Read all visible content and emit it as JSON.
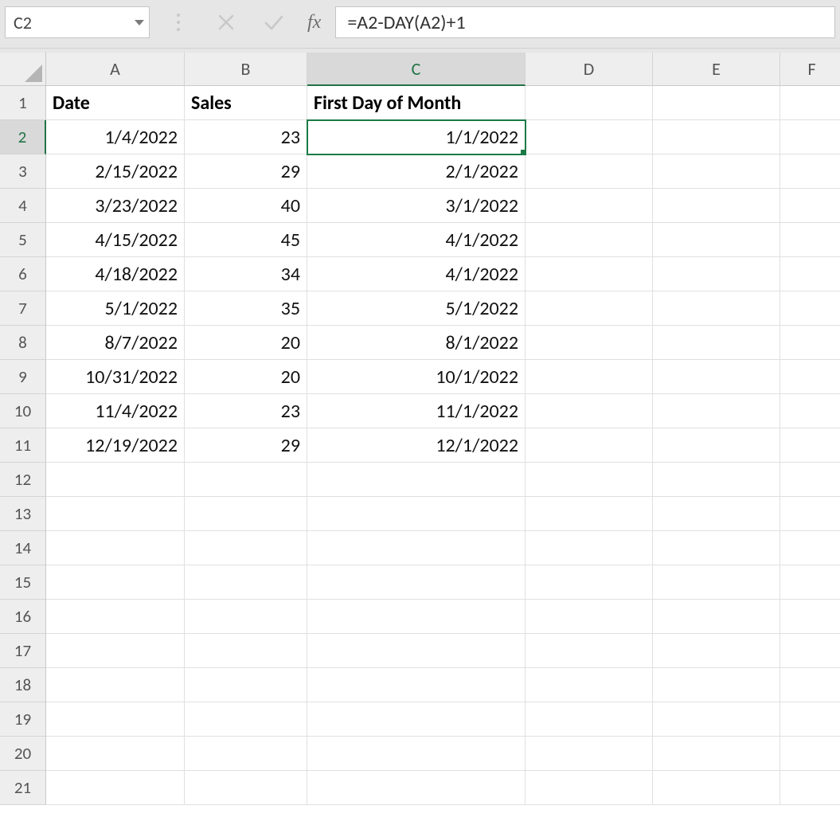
{
  "formula_bar": {
    "name_box": "C2",
    "formula": "=A2-DAY(A2)+1"
  },
  "columns": [
    "A",
    "B",
    "C",
    "D",
    "E",
    "F"
  ],
  "active_column_index": 2,
  "row_count": 21,
  "active_row": 2,
  "headers": {
    "A": "Date",
    "B": "Sales",
    "C": "First Day of Month"
  },
  "rows": [
    {
      "A": "1/4/2022",
      "B": "23",
      "C": "1/1/2022"
    },
    {
      "A": "2/15/2022",
      "B": "29",
      "C": "2/1/2022"
    },
    {
      "A": "3/23/2022",
      "B": "40",
      "C": "3/1/2022"
    },
    {
      "A": "4/15/2022",
      "B": "45",
      "C": "4/1/2022"
    },
    {
      "A": "4/18/2022",
      "B": "34",
      "C": "4/1/2022"
    },
    {
      "A": "5/1/2022",
      "B": "35",
      "C": "5/1/2022"
    },
    {
      "A": "8/7/2022",
      "B": "20",
      "C": "8/1/2022"
    },
    {
      "A": "10/31/2022",
      "B": "20",
      "C": "10/1/2022"
    },
    {
      "A": "11/4/2022",
      "B": "23",
      "C": "11/1/2022"
    },
    {
      "A": "12/19/2022",
      "B": "29",
      "C": "12/1/2022"
    }
  ],
  "selected_cell": "C2",
  "fx_label": "fx"
}
